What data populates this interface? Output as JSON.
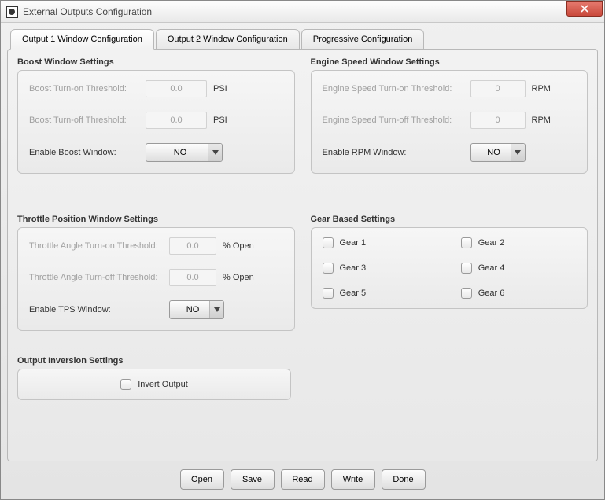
{
  "window": {
    "title": "External Outputs Configuration"
  },
  "tabs": [
    {
      "label": "Output 1 Window Configuration",
      "active": true
    },
    {
      "label": "Output 2 Window Configuration",
      "active": false
    },
    {
      "label": "Progressive Configuration",
      "active": false
    }
  ],
  "boost": {
    "title": "Boost Window Settings",
    "turn_on_label": "Boost Turn-on Threshold:",
    "turn_on_value": "0.0",
    "turn_off_label": "Boost Turn-off Threshold:",
    "turn_off_value": "0.0",
    "unit": "PSI",
    "enable_label": "Enable Boost Window:",
    "enable_value": "NO"
  },
  "engine": {
    "title": "Engine Speed Window Settings",
    "turn_on_label": "Engine Speed Turn-on Threshold:",
    "turn_on_value": "0",
    "turn_off_label": "Engine Speed Turn-off Threshold:",
    "turn_off_value": "0",
    "unit": "RPM",
    "enable_label": "Enable RPM Window:",
    "enable_value": "NO"
  },
  "tps": {
    "title": "Throttle Position Window Settings",
    "turn_on_label": "Throttle Angle Turn-on Threshold:",
    "turn_on_value": "0.0",
    "turn_off_label": "Throttle Angle Turn-off Threshold:",
    "turn_off_value": "0.0",
    "unit": "% Open",
    "enable_label": "Enable TPS Window:",
    "enable_value": "NO"
  },
  "gear": {
    "title": "Gear Based Settings",
    "items": [
      "Gear 1",
      "Gear 2",
      "Gear 3",
      "Gear 4",
      "Gear 5",
      "Gear 6"
    ]
  },
  "inversion": {
    "title": "Output Inversion Settings",
    "label": "Invert Output"
  },
  "buttons": {
    "open": "Open",
    "save": "Save",
    "read": "Read",
    "write": "Write",
    "done": "Done"
  }
}
